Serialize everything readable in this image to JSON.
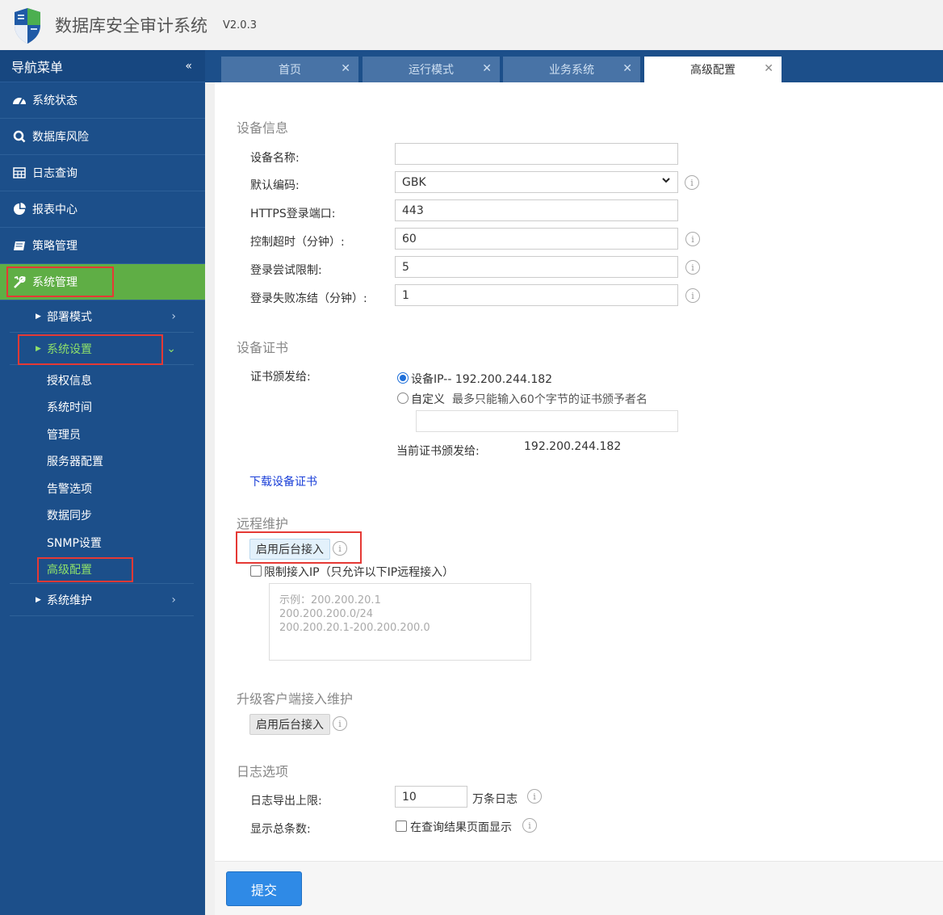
{
  "app": {
    "title": "数据库安全审计系统",
    "version": "V2.0.3"
  },
  "colors": {
    "sidebar": "#1c4f8a",
    "active_green": "#5fae45",
    "highlight_red": "#e53935",
    "primary_blue": "#2f8ae6"
  },
  "sidebar": {
    "header": "导航菜单",
    "collapse": "«",
    "items": [
      {
        "label": "系统状态",
        "icon": "gauge-icon"
      },
      {
        "label": "数据库风险",
        "icon": "search-icon"
      },
      {
        "label": "日志查询",
        "icon": "table-icon"
      },
      {
        "label": "报表中心",
        "icon": "pie-chart-icon"
      },
      {
        "label": "策略管理",
        "icon": "book-icon"
      },
      {
        "label": "系统管理",
        "icon": "tools-icon"
      }
    ],
    "sub": {
      "deploy": "部署模式",
      "settings": "系统设置",
      "maintenance": "系统维护"
    },
    "leaves": [
      "授权信息",
      "系统时间",
      "管理员",
      "服务器配置",
      "告警选项",
      "数据同步",
      "SNMP设置",
      "高级配置"
    ]
  },
  "tabs": [
    {
      "label": "首页"
    },
    {
      "label": "运行模式"
    },
    {
      "label": "业务系统"
    },
    {
      "label": "高级配置"
    }
  ],
  "device_info": {
    "title": "设备信息",
    "name_label": "设备名称:",
    "name_value": "",
    "encoding_label": "默认编码:",
    "encoding_value": "GBK",
    "https_label": "HTTPS登录端口:",
    "https_value": "443",
    "timeout_label": "控制超时（分钟）:",
    "timeout_value": "60",
    "attempt_label": "登录尝试限制:",
    "attempt_value": "5",
    "freeze_label": "登录失败冻结（分钟）:",
    "freeze_value": "1"
  },
  "cert": {
    "title": "设备证书",
    "issued_label": "证书颁发给:",
    "option_ip": "设备IP-- 192.200.244.182",
    "option_custom": "自定义",
    "custom_hint": "最多只能输入60个字节的证书颁予者名",
    "custom_value": "",
    "current_label": "当前证书颁发给:",
    "current_value": "192.200.244.182",
    "download": "下载设备证书"
  },
  "remote": {
    "title": "远程维护",
    "enable_button": "启用后台接入",
    "limit_label": "限制接入IP（只允许以下IP远程接入）",
    "placeholder": "示例：200.200.20.1\n200.200.200.0/24\n200.200.20.1-200.200.200.0"
  },
  "upgrade": {
    "title": "升级客户端接入维护",
    "enable_button": "启用后台接入"
  },
  "log": {
    "title": "日志选项",
    "export_label": "日志导出上限:",
    "export_value": "10",
    "export_unit": "万条日志",
    "total_label": "显示总条数:",
    "total_option": "在查询结果页面显示"
  },
  "submit": "提交"
}
